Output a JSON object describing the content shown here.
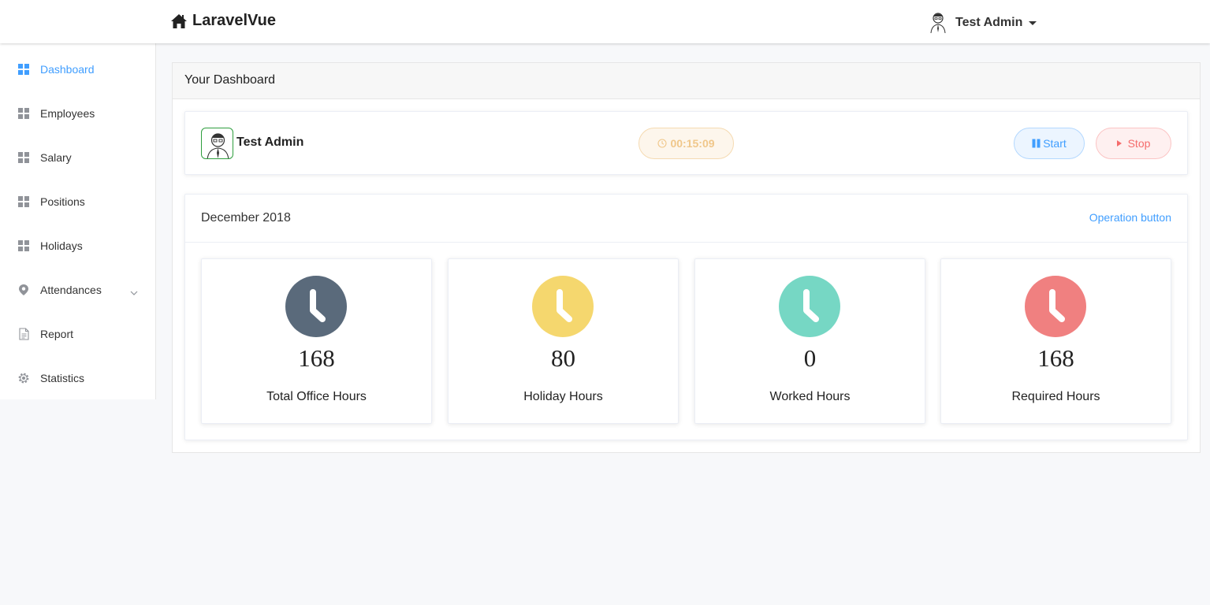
{
  "app": {
    "brand": "LaravelVue",
    "user_name": "Test Admin"
  },
  "sidebar": {
    "items": [
      {
        "label": "Dashboard",
        "icon": "grid-icon",
        "active": true
      },
      {
        "label": "Employees",
        "icon": "grid-icon"
      },
      {
        "label": "Salary",
        "icon": "grid-icon"
      },
      {
        "label": "Positions",
        "icon": "grid-icon"
      },
      {
        "label": "Holidays",
        "icon": "grid-icon"
      },
      {
        "label": "Attendances",
        "icon": "location-icon",
        "has_submenu": true
      },
      {
        "label": "Report",
        "icon": "document-icon"
      },
      {
        "label": "Statistics",
        "icon": "gear-icon"
      }
    ]
  },
  "main": {
    "panel_title": "Your Dashboard",
    "user_card": {
      "name": "Test Admin",
      "timer": "00:15:09",
      "start_label": "Start",
      "stop_label": "Stop"
    },
    "month": {
      "title": "December 2018",
      "operation_label": "Operation button"
    },
    "stats": [
      {
        "value": "168",
        "label": "Total Office Hours",
        "color": "#5a6a7b"
      },
      {
        "value": "80",
        "label": "Holiday Hours",
        "color": "#f5d76e"
      },
      {
        "value": "0",
        "label": "Worked Hours",
        "color": "#76d7c4"
      },
      {
        "value": "168",
        "label": "Required Hours",
        "color": "#f08080"
      }
    ]
  },
  "colors": {
    "accent": "#409eff",
    "danger": "#f56c6c",
    "warning": "#f0c78a"
  }
}
